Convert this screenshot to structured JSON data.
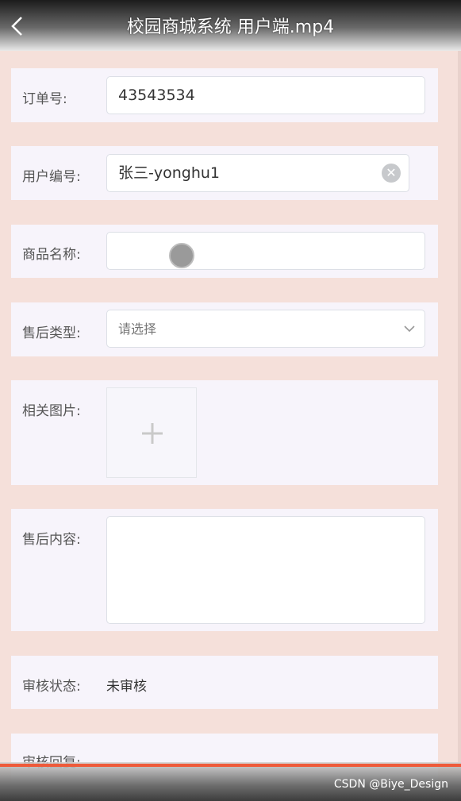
{
  "header": {
    "title": "校园商城系统 用户端.mp4",
    "back_icon": "chevron-left-icon"
  },
  "form": {
    "order_no": {
      "label": "订单号:",
      "value": "43543534"
    },
    "user_no": {
      "label": "用户编号:",
      "value": "张三-yonghu1"
    },
    "product_name": {
      "label": "商品名称:",
      "value": ""
    },
    "aftersale_type": {
      "label": "售后类型:",
      "placeholder": "请选择"
    },
    "images": {
      "label": "相关图片:"
    },
    "content": {
      "label": "售后内容:",
      "value": ""
    },
    "review_status": {
      "label": "审核状态:",
      "value": "未审核"
    },
    "review_reply": {
      "label": "审核回复:"
    }
  },
  "footer": {
    "watermark": "CSDN @Biye_Design"
  },
  "colors": {
    "background": "#f5e0da",
    "card": "#f7f4fb",
    "progress": "#ee5a3a"
  }
}
